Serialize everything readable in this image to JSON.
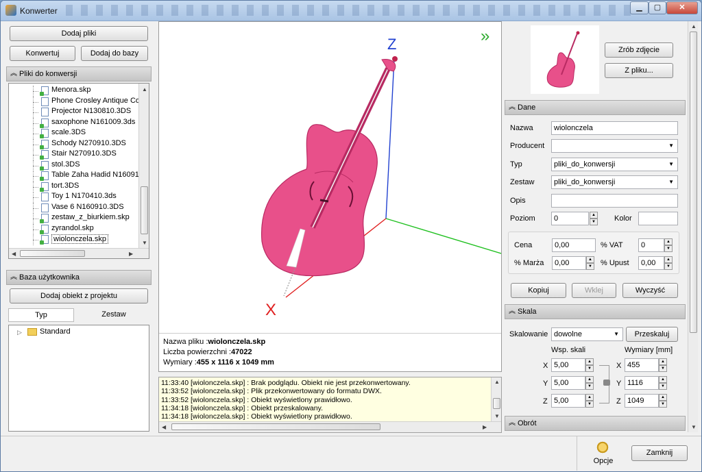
{
  "window": {
    "title": "Konwerter",
    "buttons": [
      "▁",
      "▢",
      "✕"
    ]
  },
  "left": {
    "add_files": "Dodaj pliki",
    "convert": "Konwertuj",
    "add_to_db": "Dodaj do bazy",
    "files_section": "Pliki do konwersji",
    "files": [
      {
        "name": "Menora.skp",
        "converted": true
      },
      {
        "name": "Phone Crosley Antique Cou",
        "converted": false
      },
      {
        "name": "Projector N130810.3DS",
        "converted": false
      },
      {
        "name": "saxophone N161009.3ds",
        "converted": true
      },
      {
        "name": "scale.3DS",
        "converted": true
      },
      {
        "name": "Schody N270910.3DS",
        "converted": true
      },
      {
        "name": "Stair N270910.3DS",
        "converted": true
      },
      {
        "name": "stol.3DS",
        "converted": true
      },
      {
        "name": "Table Zaha Hadid N160910",
        "converted": true
      },
      {
        "name": "tort.3DS",
        "converted": true
      },
      {
        "name": "Toy 1 N170410.3ds",
        "converted": false
      },
      {
        "name": "Vase 6 N160910.3DS",
        "converted": false
      },
      {
        "name": "zestaw_z_biurkiem.skp",
        "converted": true
      },
      {
        "name": "zyrandol.skp",
        "converted": true
      },
      {
        "name": "wiolonczela.skp",
        "converted": true
      }
    ],
    "user_db_section": "Baza użytkownika",
    "add_from_project": "Dodaj obiekt z projektu",
    "tab_type": "Typ",
    "tab_set": "Zestaw",
    "tree_root": "Standard"
  },
  "viewer": {
    "axis_z": "Z",
    "axis_x": "X",
    "expand": "»",
    "file_name_label": "Nazwa pliku :",
    "file_name": "wiolonczela.skp",
    "faces_label": "Liczba powierzchni :",
    "faces": "47022",
    "dims_label": "Wymiary :",
    "dims": "455 x 1116 x 1049 mm"
  },
  "log": [
    "11:33:40 [wiolonczela.skp] : Brak podglądu. Obiekt nie jest przekonwertowany.",
    "11:33:52 [wiolonczela.skp] : Plik przekonwertowany do formatu DWX.",
    "11:33:52 [wiolonczela.skp] : Obiekt wyświetlony prawidłowo.",
    "11:34:18 [wiolonczela.skp] : Obiekt przeskalowany.",
    "11:34:18 [wiolonczela.skp] : Obiekt wyświetlony prawidłowo."
  ],
  "right": {
    "take_photo": "Zrób zdjęcie",
    "from_file": "Z pliku...",
    "data_section": "Dane",
    "name_label": "Nazwa",
    "name_value": "wiolonczela",
    "producer_label": "Producent",
    "producer_value": "",
    "type_label": "Typ",
    "type_value": "pliki_do_konwersji",
    "set_label": "Zestaw",
    "set_value": "pliki_do_konwersji",
    "desc_label": "Opis",
    "desc_value": "",
    "level_label": "Poziom",
    "level_value": "0",
    "color_label": "Kolor",
    "color_value": "",
    "price_label": "Cena",
    "price_value": "0,00",
    "vat_label": "% VAT",
    "vat_value": "0",
    "margin_label": "% Marża",
    "margin_value": "0,00",
    "discount_label": "% Upust",
    "discount_value": "0,00",
    "copy": "Kopiuj",
    "paste": "Wklej",
    "clear": "Wyczyść",
    "scale_section": "Skala",
    "scaling_label": "Skalowanie",
    "scaling_value": "dowolne",
    "rescale": "Przeskaluj",
    "scale_coef_label": "Wsp. skali",
    "dims_label": "Wymiary [mm]",
    "sx": "5,00",
    "sy": "5,00",
    "sz": "5,00",
    "dx": "455",
    "dy": "1116",
    "dz": "1049",
    "x": "X",
    "y": "Y",
    "z": "Z",
    "rotation_section": "Obrót"
  },
  "footer": {
    "options": "Opcje",
    "close": "Zamknij"
  },
  "colors": {
    "object": "#e8508a",
    "axis_x": "#e02020",
    "axis_y": "#20c020",
    "axis_z": "#2040d0"
  }
}
